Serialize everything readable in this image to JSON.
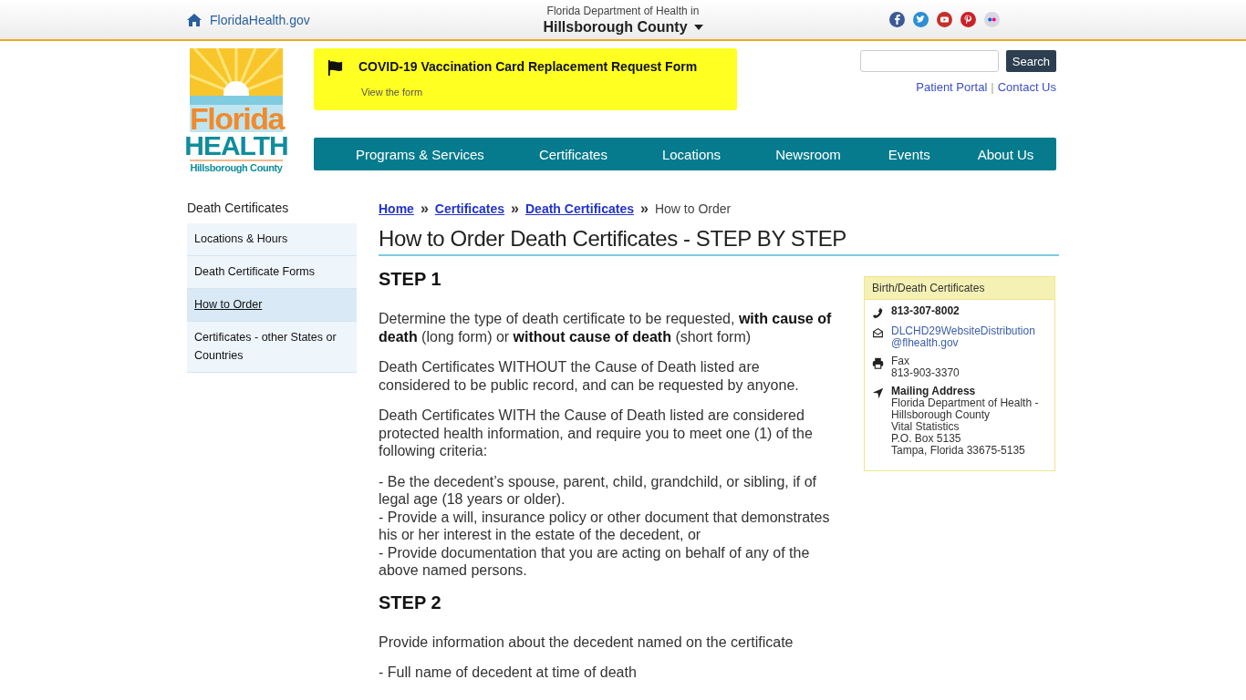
{
  "top_bar": {
    "home_link": "FloridaHealth.gov",
    "department": "Florida Department of Health in",
    "county": "Hillsborough County",
    "social": [
      {
        "kind": "facebook"
      },
      {
        "kind": "twitter"
      },
      {
        "kind": "youtube"
      },
      {
        "kind": "pinterest"
      },
      {
        "kind": "flickr"
      }
    ]
  },
  "logo": {
    "line_1": "Florida",
    "line_2": "HEALTH",
    "line_3": "Hillsborough County"
  },
  "alert": {
    "title": "COVID-19 Vaccination Card Replacement Request Form",
    "link": "View the form"
  },
  "search": {
    "button": "Search"
  },
  "utility_links": {
    "links": [
      "Patient Portal",
      "Contact Us"
    ],
    "separator": "|"
  },
  "nav": [
    "Programs & Services",
    "Certificates",
    "Locations",
    "Newsroom",
    "Events",
    "About Us"
  ],
  "sidebar": {
    "title": "Death Certificates",
    "items": [
      {
        "label": "Locations & Hours",
        "selected": false
      },
      {
        "label": "Death Certificate Forms",
        "selected": false
      },
      {
        "label": "How to Order",
        "selected": true
      },
      {
        "label": "Certificates - other States or Countries",
        "selected": false
      }
    ]
  },
  "breadcrumb": {
    "links": [
      "Home",
      "Certificates",
      "Death Certificates"
    ],
    "separator": "»",
    "current": "How to Order"
  },
  "page_title": "How to Order Death Certificates - STEP BY STEP",
  "sections": [
    {
      "heading": "STEP 1",
      "blocks": [
        {
          "kind": "paragraph",
          "text": "Determine the type of death certificate to be requested, **with cause of death** (long form) or **without cause of death** (short form)"
        },
        {
          "kind": "paragraph",
          "text": "Death Certificates WITHOUT the Cause of Death listed are considered to be public record, and can be requested by anyone."
        },
        {
          "kind": "paragraph",
          "text": "Death Certificates WITH the Cause of Death listed are considered protected health information, and require you to meet one (1) of the following criteria:"
        },
        {
          "kind": "lines",
          "lines": [
            "-  Be the decedent’s spouse, parent, child, grandchild, or sibling, if of legal age (18 years or older).",
            "-  Provide a will, insurance policy or other document that demonstrates his or her interest in the estate of the decedent, or",
            "-  Provide documentation that you are acting on behalf of any of the above named persons."
          ]
        }
      ]
    },
    {
      "heading": "STEP 2",
      "blocks": [
        {
          "kind": "paragraph",
          "text": "Provide information about the decedent named on the certificate"
        },
        {
          "kind": "lines",
          "lines": [
            "-  Full name of decedent at time of death"
          ]
        }
      ]
    }
  ],
  "contact_box": {
    "title": "Birth/Death Certificates",
    "items": [
      {
        "kind": "phone",
        "lines": [
          "813-307-8002"
        ]
      },
      {
        "kind": "email",
        "lines": [
          "DLCHD29WebsiteDistribution",
          "@flhealth.gov"
        ]
      },
      {
        "kind": "fax",
        "lines": [
          "Fax",
          "813-903-3370"
        ]
      },
      {
        "kind": "address",
        "lines": [
          "Mailing Address",
          "Florida Department of Health -",
          "Hillsborough County",
          "Vital Statistics",
          "P.O. Box 5135",
          "Tampa, Florida 33675-5135"
        ]
      }
    ]
  }
}
